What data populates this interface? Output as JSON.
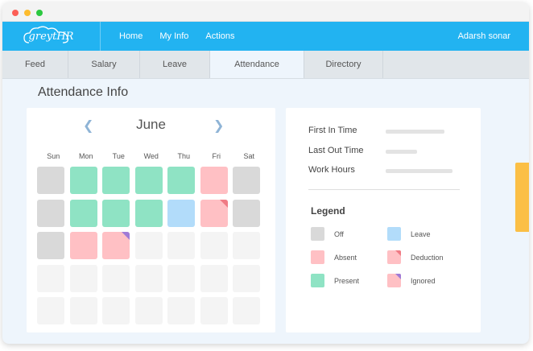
{
  "app": {
    "logo_text": "greytHR"
  },
  "topnav": {
    "links": [
      {
        "label": "Home"
      },
      {
        "label": "My Info"
      },
      {
        "label": "Actions"
      }
    ],
    "user_name": "Adarsh sonar"
  },
  "subtabs": [
    {
      "label": "Feed",
      "active": false
    },
    {
      "label": "Salary",
      "active": false
    },
    {
      "label": "Leave",
      "active": false
    },
    {
      "label": "Attendance",
      "active": true
    },
    {
      "label": "Directory",
      "active": false
    }
  ],
  "page_title": "Attendance Info",
  "calendar": {
    "month": "June",
    "prev_icon": "chevron-left-icon",
    "next_icon": "chevron-right-icon",
    "weekdays": [
      "Sun",
      "Mon",
      "Tue",
      "Wed",
      "Thu",
      "Fri",
      "Sat"
    ],
    "rows": [
      [
        "off",
        "present",
        "present",
        "present",
        "present",
        "absent",
        "off"
      ],
      [
        "off",
        "present",
        "present",
        "present",
        "leave",
        "deduction",
        "off"
      ],
      [
        "off",
        "absent",
        "ignored",
        "empty",
        "empty",
        "empty",
        "empty"
      ],
      [
        "empty",
        "empty",
        "empty",
        "empty",
        "empty",
        "empty",
        "empty"
      ],
      [
        "empty",
        "empty",
        "empty",
        "empty",
        "empty",
        "empty",
        "empty"
      ]
    ]
  },
  "info": {
    "first_in_label": "First In Time",
    "last_out_label": "Last Out Time",
    "work_hours_label": "Work Hours"
  },
  "legend": {
    "title": "Legend",
    "items": [
      {
        "key": "off",
        "label": "Off"
      },
      {
        "key": "leave",
        "label": "Leave"
      },
      {
        "key": "absent",
        "label": "Absent"
      },
      {
        "key": "deduction",
        "label": "Deduction"
      },
      {
        "key": "present",
        "label": "Present"
      },
      {
        "key": "ignored",
        "label": "Ignored"
      }
    ]
  },
  "colors": {
    "brand": "#22b3f1",
    "off": "#d9d9d9",
    "present": "#8fe3c4",
    "absent": "#ffc0c4",
    "leave": "#b2dcfa",
    "deduction_corner": "#f07a84",
    "ignored_corner": "#a07ad6",
    "handle": "#fbbf45"
  }
}
